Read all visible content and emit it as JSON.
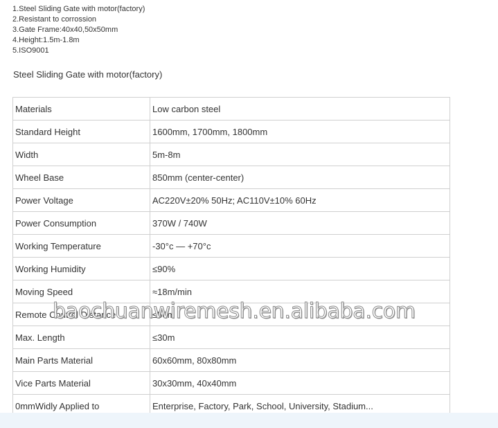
{
  "features": [
    "1.Steel Sliding Gate with motor(factory)",
    "2.Resistant to corrossion",
    "3.Gate Frame:40x40,50x50mm",
    "4.Height:1.5m-1.8m",
    "5.ISO9001"
  ],
  "heading": "Steel Sliding Gate with motor(factory)",
  "spec_rows": [
    {
      "label": "Materials",
      "value": "Low carbon steel"
    },
    {
      "label": "Standard Height",
      "value": "1600mm, 1700mm, 1800mm"
    },
    {
      "label": "Width",
      "value": "5m-8m"
    },
    {
      "label": "Wheel Base",
      "value": "850mm (center-center)"
    },
    {
      "label": "Power Voltage",
      "value": "AC220V±20% 50Hz; AC110V±10% 60Hz"
    },
    {
      "label": "Power Consumption",
      "value": "370W / 740W"
    },
    {
      "label": "Working Temperature",
      "value": "-30°c — +70°c"
    },
    {
      "label": "Working Humidity",
      "value": "≤90%"
    },
    {
      "label": "Moving Speed",
      "value": "≈18m/min"
    },
    {
      "label": "Remote Control Distance",
      "value": "≤50m"
    },
    {
      "label": "Max. Length",
      "value": "≤30m"
    },
    {
      "label": "Main Parts Material",
      "value": "60x60mm, 80x80mm"
    },
    {
      "label": "Vice Parts Material",
      "value": "30x30mm, 40x40mm"
    },
    {
      "label": "0mmWidly Applied to",
      "value": "Enterprise, Factory, Park, School, University, Stadium..."
    }
  ],
  "watermark": "baochuanwiremesh.en.alibaba.com"
}
